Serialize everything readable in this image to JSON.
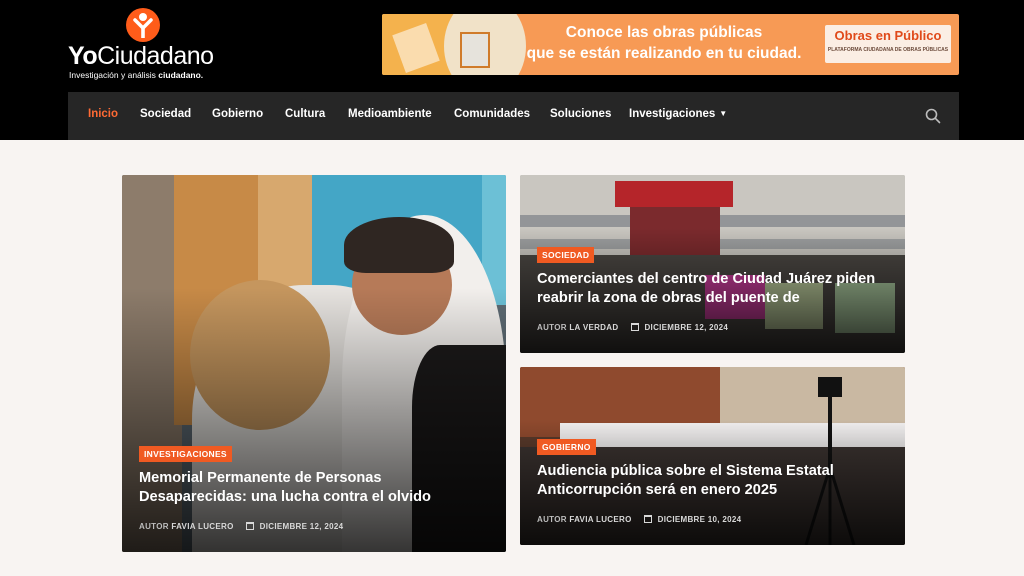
{
  "header": {
    "logo": {
      "name_bold": "Yo",
      "name_regular": "Ciudadano",
      "tagline_regular": "Investigación y análisis ",
      "tagline_bold": "ciudadano."
    },
    "banner": {
      "line1": "Conoce las obras públicas",
      "line2": "que se están realizando en tu ciudad.",
      "brand": "Obras en Público",
      "brand_sub": "PLATAFORMA CIUDADANA DE OBRAS PÚBLICAS"
    }
  },
  "nav": {
    "items": [
      {
        "label": "Inicio",
        "active": true
      },
      {
        "label": "Sociedad"
      },
      {
        "label": "Gobierno"
      },
      {
        "label": "Cultura"
      },
      {
        "label": "Medioambiente"
      },
      {
        "label": "Comunidades"
      },
      {
        "label": "Soluciones"
      },
      {
        "label": "Investigaciones",
        "has_dropdown": true
      }
    ],
    "search_icon": "search-icon"
  },
  "articles": [
    {
      "category": "INVESTIGACIONES",
      "title": "Memorial Permanente de Personas Desaparecidas: una lucha contra el olvido",
      "author_prefix": "AUTOR",
      "author": "FAVIA LUCERO",
      "date": "DICIEMBRE 12, 2024"
    },
    {
      "category": "SOCIEDAD",
      "title": "Comerciantes del centro de Ciudad Juárez piden reabrir la zona de obras del puente de",
      "author_prefix": "AUTOR",
      "author": "LA VERDAD",
      "date": "DICIEMBRE 12, 2024"
    },
    {
      "category": "GOBIERNO",
      "title": "Audiencia pública sobre el Sistema Estatal Anticorrupción será en enero 2025",
      "author_prefix": "AUTOR",
      "author": "FAVIA LUCERO",
      "date": "DICIEMBRE 10, 2024"
    }
  ],
  "colors": {
    "accent": "#f05a22",
    "nav_bg": "#262626",
    "header_bg": "#000000",
    "page_bg": "#f8f4f2"
  }
}
